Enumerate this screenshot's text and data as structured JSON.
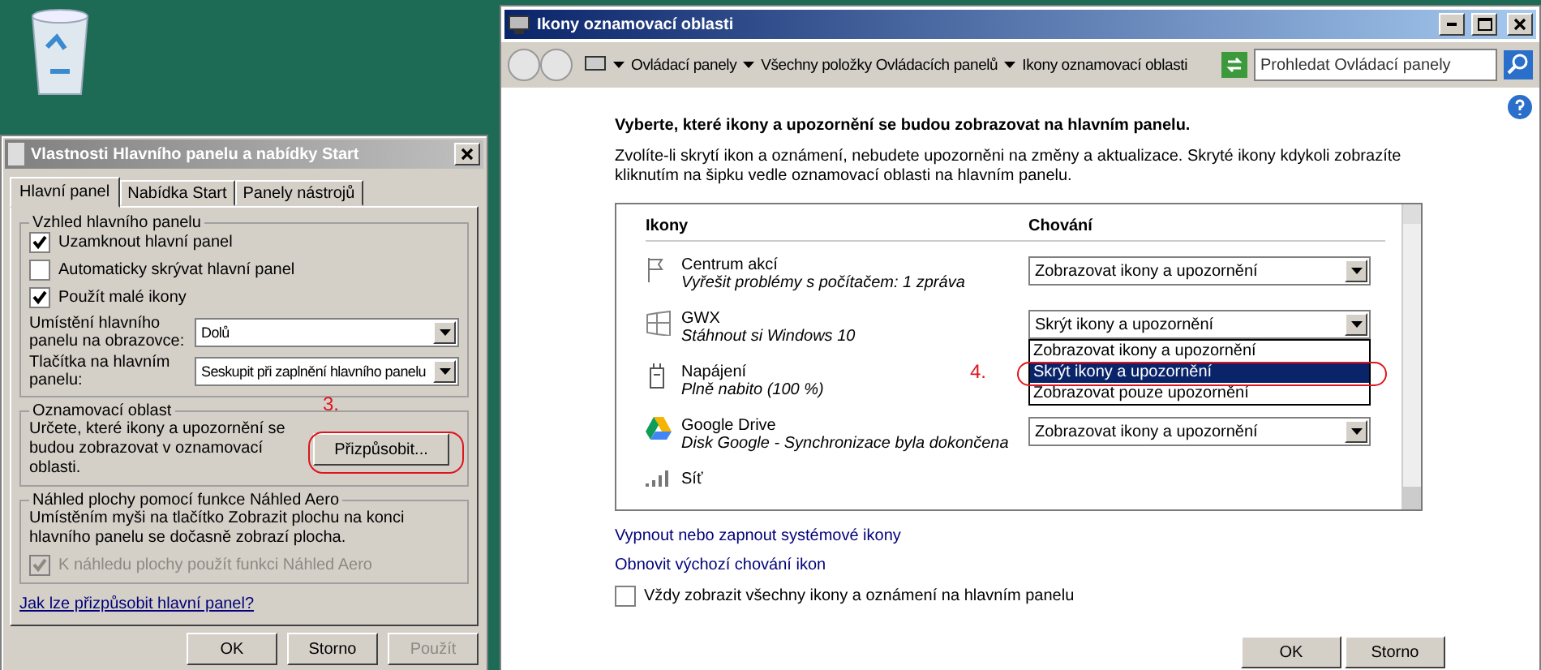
{
  "properties_dialog": {
    "title": "Vlastnosti Hlavního panelu a nabídky Start",
    "tabs": [
      {
        "label": "Hlavní panel",
        "selected": true
      },
      {
        "label": "Nabídka Start",
        "selected": false
      },
      {
        "label": "Panely nástrojů",
        "selected": false
      }
    ],
    "appearance_group": {
      "title": "Vzhled hlavního panelu",
      "checkboxes": [
        {
          "label": "Uzamknout hlavní panel",
          "checked": true
        },
        {
          "label": "Automaticky skrývat hlavní panel",
          "checked": false
        },
        {
          "label": "Použít malé ikony",
          "checked": true
        }
      ],
      "fields": [
        {
          "label": "Umístění hlavního panelu na obrazovce:",
          "value": "Dolů"
        },
        {
          "label": "Tlačítka na hlavním panelu:",
          "value": "Seskupit při zaplnění hlavního panelu"
        }
      ]
    },
    "annotation": "3.",
    "notification_group": {
      "title": "Oznamovací oblast",
      "text": "Určete, které ikony a upozornění se budou zobrazovat v oznamovací oblasti.",
      "button": "Přizpůsobit..."
    },
    "aero_group": {
      "title": "Náhled plochy pomocí funkce Náhled Aero",
      "text": "Umístěním myši na tlačítko Zobrazit plochu na konci hlavního panelu se dočasně zobrazí plocha.",
      "checkbox": {
        "label": "K náhledu plochy použít funkci Náhled Aero",
        "checked": true,
        "disabled": true
      }
    },
    "help_link": "Jak lze přizpůsobit hlavní panel?",
    "buttons": [
      {
        "label": "OK",
        "disabled": false
      },
      {
        "label": "Storno",
        "disabled": false
      },
      {
        "label": "Použít",
        "disabled": true
      }
    ]
  },
  "notification_window": {
    "title": "Ikony oznamovací oblasti",
    "breadcrumb": [
      "Ovládací panely",
      "Všechny položky Ovládacích panelů",
      "Ikony oznamovací oblasti"
    ],
    "search": {
      "placeholder": "Prohledat Ovládací panely"
    },
    "heading": "Vyberte, které ikony a upozornění se budou zobrazovat na hlavním panelu.",
    "description": "Zvolíte-li skrytí ikon a oznámení, nebudete upozorněni na změny a aktualizace. Skryté ikony kdykoli zobrazíte kliknutím na šipku vedle oznamovací oblasti na hlavním panelu.",
    "columns": [
      "Ikony",
      "Chování"
    ],
    "rows": [
      {
        "kind": "flag",
        "name": "Centrum akcí",
        "description": "Vyřešit problémy s počítačem: 1 zpráva",
        "behavior": "Zobrazovat ikony a upozornění"
      },
      {
        "kind": "windows",
        "name": "GWX",
        "description": "Stáhnout si Windows 10",
        "behavior": "Skrýt ikony a upozornění"
      },
      {
        "kind": "power",
        "name": "Napájení",
        "description": "Plně nabito (100 %)"
      },
      {
        "kind": "drive",
        "name": "Google Drive",
        "description": "Disk Google - Synchronizace byla dokončena",
        "behavior": "Zobrazovat ikony a upozornění"
      },
      {
        "kind": "network",
        "name": "Síť"
      }
    ],
    "dropdown_options": [
      {
        "label": "Zobrazovat ikony a upozornění",
        "selected": false
      },
      {
        "label": "Skrýt ikony a upozornění",
        "selected": true
      },
      {
        "label": "Zobrazovat pouze upozornění",
        "selected": false
      }
    ],
    "annotation": "4.",
    "links": [
      "Vypnout nebo zapnout systémové ikony",
      "Obnovit výchozí chování ikon"
    ],
    "checkbox": {
      "label": "Vždy zobrazit všechny ikony a oznámení na hlavním panelu",
      "checked": false
    },
    "buttons": [
      "OK",
      "Storno"
    ]
  }
}
